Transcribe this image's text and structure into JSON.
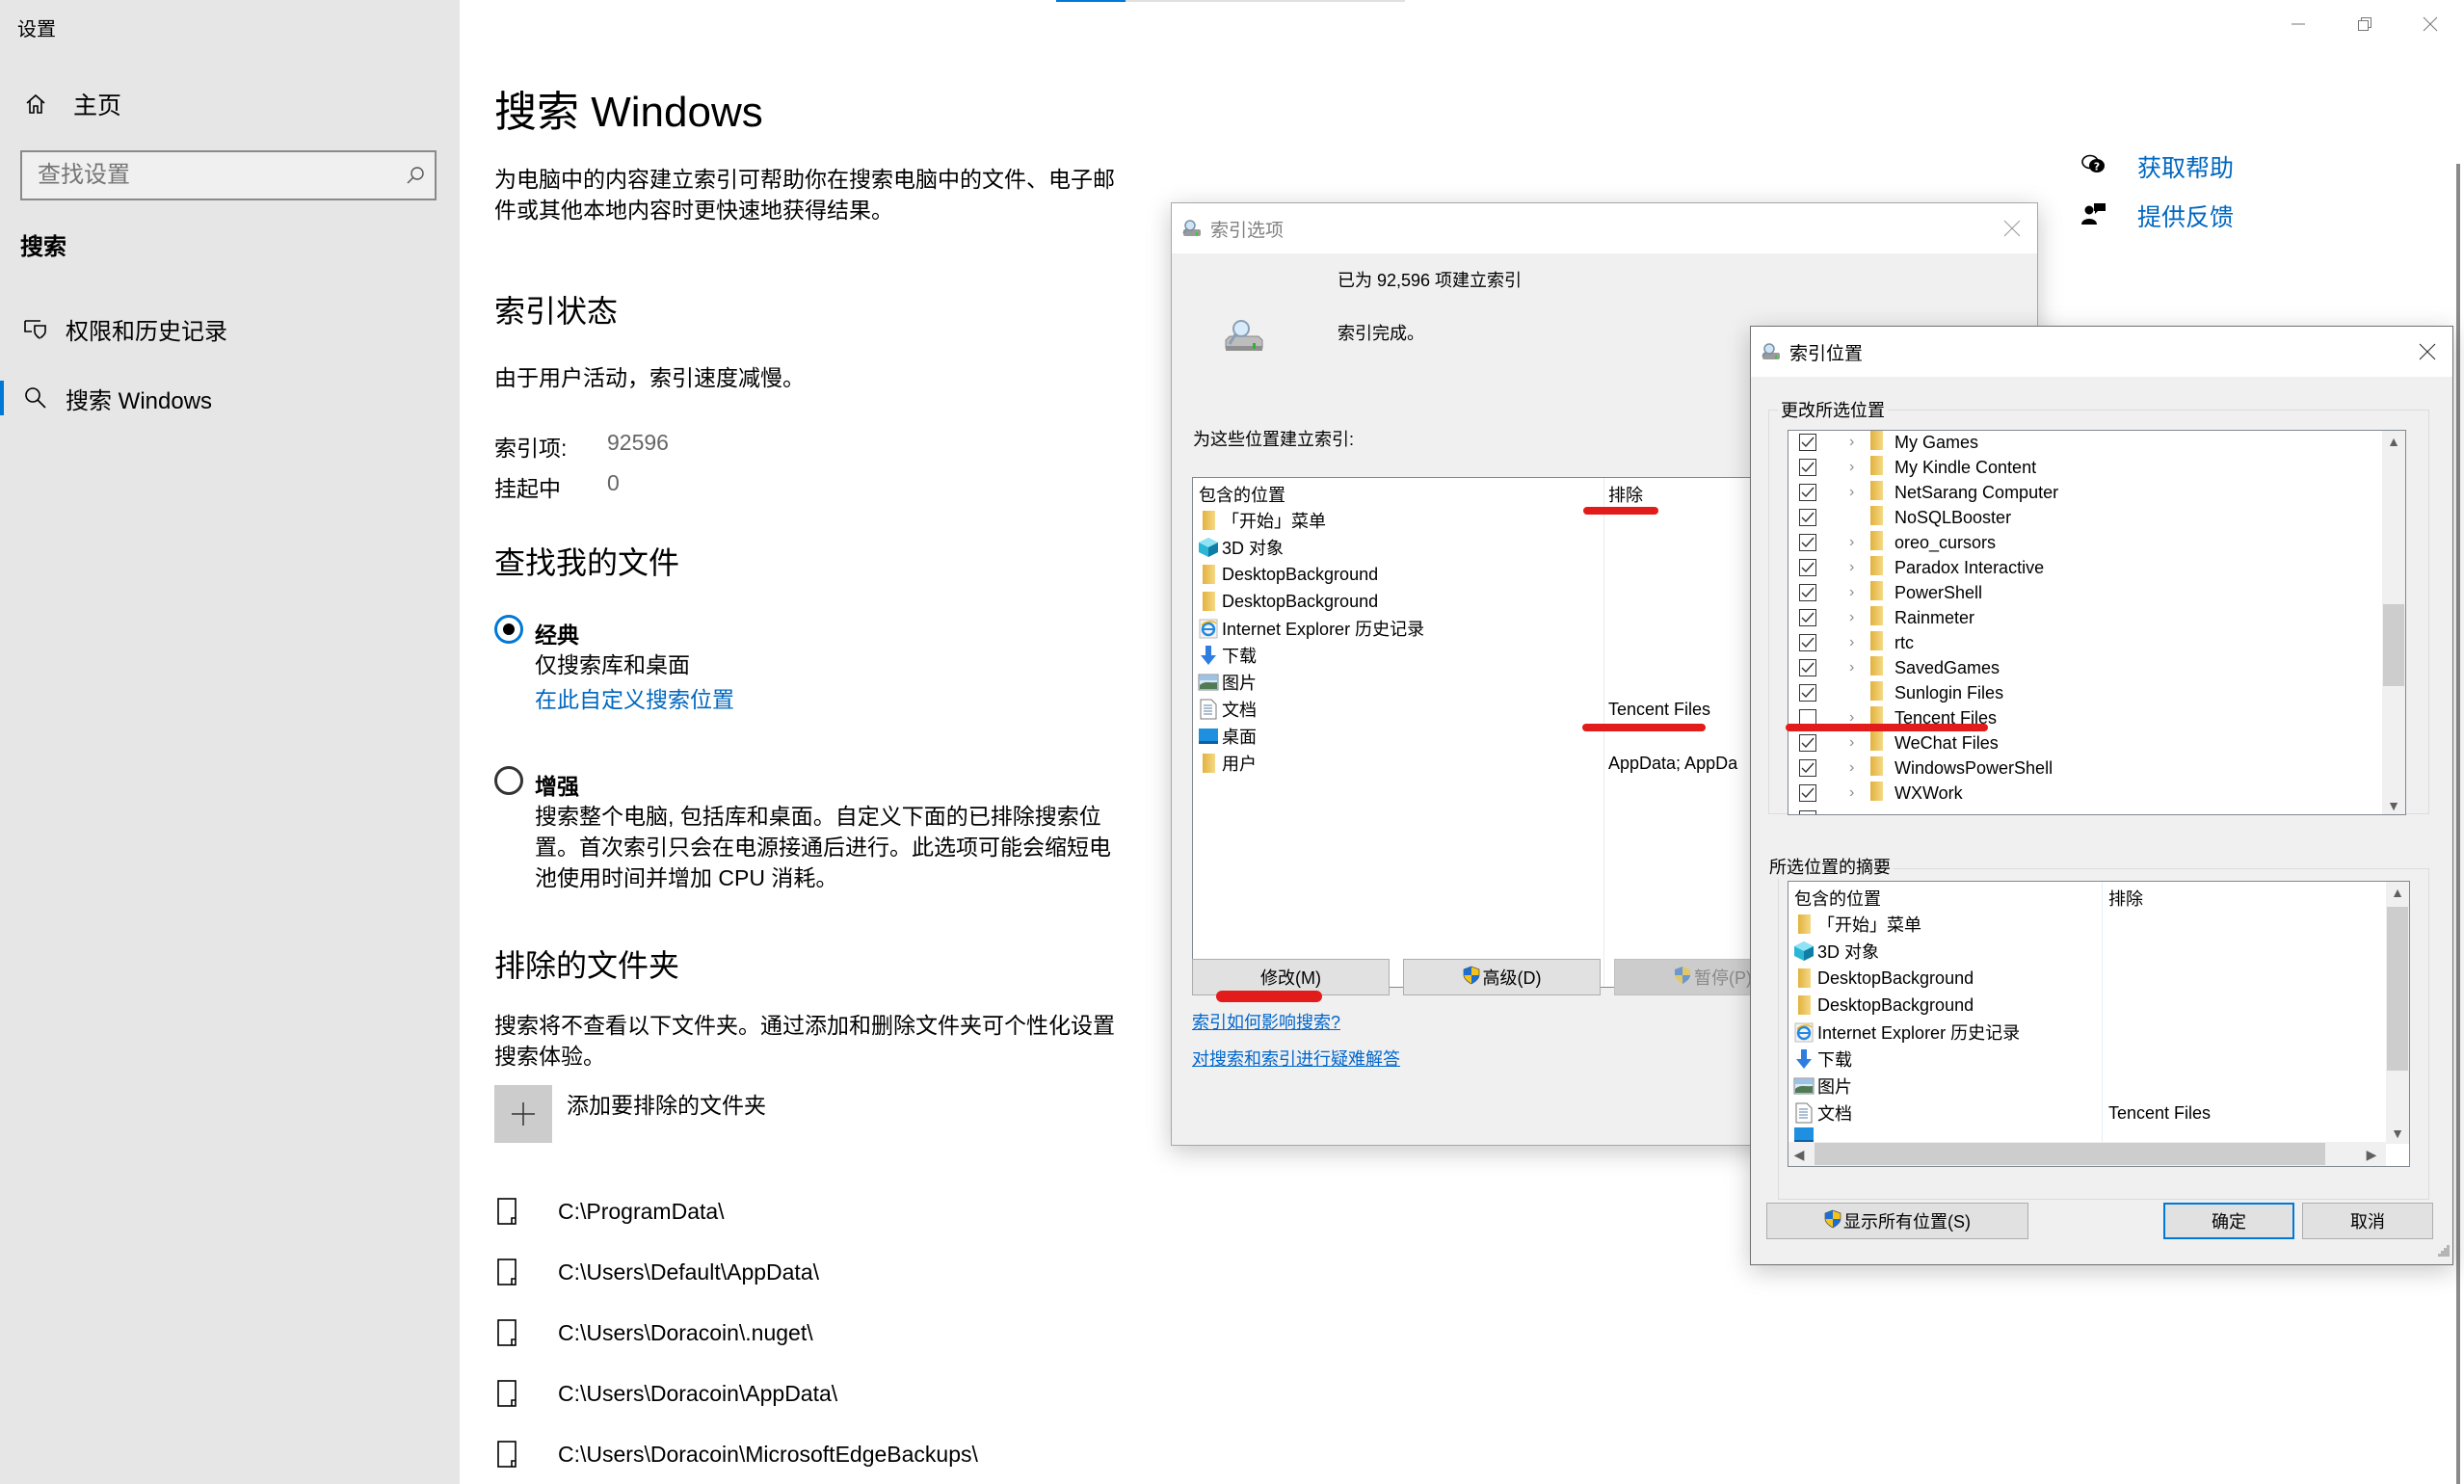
{
  "window": {
    "app_title": "设置",
    "controls": {
      "minimize": "minimize",
      "restore": "restore",
      "close": "close"
    },
    "top_progress_fraction": 0.2
  },
  "sidebar": {
    "home_label": "主页",
    "search_placeholder": "查找设置",
    "section_label": "搜索",
    "items": [
      {
        "label": "权限和历史记录",
        "icon": "privacy-shield-icon",
        "selected": false
      },
      {
        "label": "搜索 Windows",
        "icon": "search-icon",
        "selected": true
      }
    ]
  },
  "main": {
    "title": "搜索 Windows",
    "intro": "为电脑中的内容建立索引可帮助你在搜索电脑中的文件、电子邮件或其他本地内容时更快速地获得结果。",
    "index_status": {
      "heading": "索引状态",
      "message": "由于用户活动，索引速度减慢。",
      "indexed_label": "索引项:",
      "indexed_value": "92596",
      "pending_label": "挂起中",
      "pending_value": "0"
    },
    "find_files": {
      "heading": "查找我的文件",
      "classic_title": "经典",
      "classic_desc": "仅搜索库和桌面",
      "classic_link": "在此自定义搜索位置",
      "classic_selected": true,
      "enhanced_title": "增强",
      "enhanced_desc": "搜索整个电脑, 包括库和桌面。自定义下面的已排除搜索位置。首次索引只会在电源接通后进行。此选项可能会缩短电池使用时间并增加 CPU 消耗。",
      "enhanced_selected": false
    },
    "excluded": {
      "heading": "排除的文件夹",
      "description": "搜索将不查看以下文件夹。通过添加和删除文件夹可个性化设置搜索体验。",
      "add_label": "添加要排除的文件夹",
      "folders": [
        "C:\\ProgramData\\",
        "C:\\Users\\Default\\AppData\\",
        "C:\\Users\\Doracoin\\.nuget\\",
        "C:\\Users\\Doracoin\\AppData\\",
        "C:\\Users\\Doracoin\\MicrosoftEdgeBackups\\"
      ]
    },
    "help": {
      "get_help": "获取帮助",
      "feedback": "提供反馈"
    }
  },
  "indexing_options_dialog": {
    "title": "索引选项",
    "indexed_count_text": "已为 92,596 项建立索引",
    "status_text": "索引完成。",
    "locations_label": "为这些位置建立索引:",
    "columns": {
      "included": "包含的位置",
      "excluded": "排除"
    },
    "rows": [
      {
        "icon": "folder-icon",
        "name": "「开始」菜单",
        "excluded": ""
      },
      {
        "icon": "3d-objects-icon",
        "name": "3D 对象",
        "excluded": ""
      },
      {
        "icon": "folder-icon",
        "name": "DesktopBackground",
        "excluded": ""
      },
      {
        "icon": "folder-icon",
        "name": "DesktopBackground",
        "excluded": ""
      },
      {
        "icon": "internet-explorer-icon",
        "name": "Internet Explorer 历史记录",
        "excluded": ""
      },
      {
        "icon": "download-arrow-icon",
        "name": "下载",
        "excluded": ""
      },
      {
        "icon": "pictures-icon",
        "name": "图片",
        "excluded": ""
      },
      {
        "icon": "document-icon",
        "name": "文档",
        "excluded": "Tencent Files"
      },
      {
        "icon": "desktop-icon",
        "name": "桌面",
        "excluded": ""
      },
      {
        "icon": "folder-icon",
        "name": "用户",
        "excluded": "AppData; AppDa"
      }
    ],
    "buttons": {
      "modify": "修改(M)",
      "advanced": "高级(D)",
      "pause": "暂停(P)"
    },
    "links": {
      "how_affects": "索引如何影响搜索?",
      "troubleshoot": "对搜索和索引进行疑难解答"
    }
  },
  "indexed_locations_dialog": {
    "title": "索引位置",
    "change_group_label": "更改所选位置",
    "tree": [
      {
        "name": "My Games",
        "checked": true,
        "expandable": true
      },
      {
        "name": "My Kindle Content",
        "checked": true,
        "expandable": true
      },
      {
        "name": "NetSarang Computer",
        "checked": true,
        "expandable": true
      },
      {
        "name": "NoSQLBooster",
        "checked": true,
        "expandable": false
      },
      {
        "name": "oreo_cursors",
        "checked": true,
        "expandable": true
      },
      {
        "name": "Paradox Interactive",
        "checked": true,
        "expandable": true
      },
      {
        "name": "PowerShell",
        "checked": true,
        "expandable": true
      },
      {
        "name": "Rainmeter",
        "checked": true,
        "expandable": true
      },
      {
        "name": "rtc",
        "checked": true,
        "expandable": true
      },
      {
        "name": "SavedGames",
        "checked": true,
        "expandable": true
      },
      {
        "name": "Sunlogin Files",
        "checked": true,
        "expandable": false
      },
      {
        "name": "Tencent Files",
        "checked": false,
        "expandable": true
      },
      {
        "name": "WeChat Files",
        "checked": true,
        "expandable": true
      },
      {
        "name": "WindowsPowerShell",
        "checked": true,
        "expandable": true
      },
      {
        "name": "WXWork",
        "checked": true,
        "expandable": true
      }
    ],
    "summary_group_label": "所选位置的摘要",
    "summary_columns": {
      "included": "包含的位置",
      "excluded": "排除"
    },
    "summary_rows": [
      {
        "icon": "folder-icon",
        "name": "「开始」菜单",
        "excluded": ""
      },
      {
        "icon": "3d-objects-icon",
        "name": "3D 对象",
        "excluded": ""
      },
      {
        "icon": "folder-icon",
        "name": "DesktopBackground",
        "excluded": ""
      },
      {
        "icon": "folder-icon",
        "name": "DesktopBackground",
        "excluded": ""
      },
      {
        "icon": "internet-explorer-icon",
        "name": "Internet Explorer 历史记录",
        "excluded": ""
      },
      {
        "icon": "download-arrow-icon",
        "name": "下载",
        "excluded": ""
      },
      {
        "icon": "pictures-icon",
        "name": "图片",
        "excluded": ""
      },
      {
        "icon": "document-icon",
        "name": "文档",
        "excluded": "Tencent Files"
      }
    ],
    "buttons": {
      "show_all": "显示所有位置(S)",
      "ok": "确定",
      "cancel": "取消"
    }
  },
  "colors": {
    "accent": "#0078d7",
    "link": "#0067c0",
    "annotation_red": "#e21b1b",
    "sidebar_bg": "#e6e6e6",
    "dialog_bg": "#f0f0f0"
  }
}
